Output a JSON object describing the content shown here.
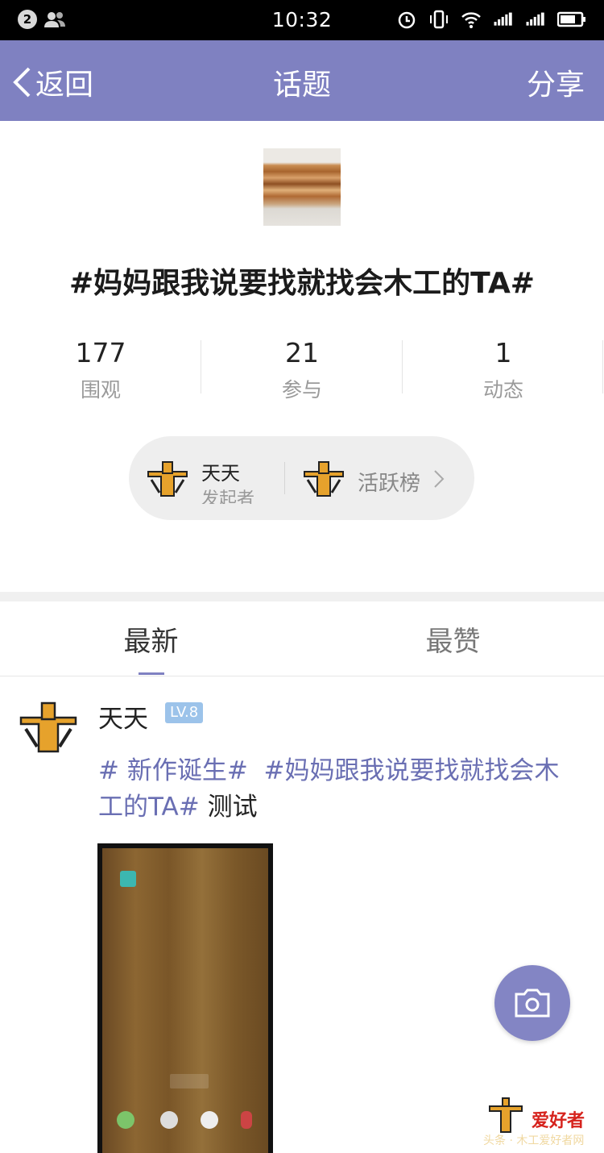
{
  "status_bar": {
    "notification_count": "2",
    "time": "10:32",
    "icons": [
      "people-icon",
      "alarm-icon",
      "vibrate-icon",
      "wifi-icon",
      "signal-1-icon",
      "signal-2-icon",
      "battery-icon"
    ]
  },
  "nav": {
    "back_label": "返回",
    "title": "话题",
    "share_label": "分享"
  },
  "topic": {
    "title": "#妈妈跟我说要找就找会木工的TA#",
    "stats": [
      {
        "value": "177",
        "label": "围观"
      },
      {
        "value": "21",
        "label": "参与"
      },
      {
        "value": "1",
        "label": "动态"
      }
    ],
    "initiator": {
      "name": "天天",
      "role": "发起者"
    },
    "ranking_label": "活跃榜"
  },
  "tabs": [
    {
      "label": "最新",
      "active": true
    },
    {
      "label": "最赞",
      "active": false
    }
  ],
  "post": {
    "author": "天天",
    "level": "LV.8",
    "hashtag_1": "# 新作诞生#",
    "hashtag_2": "#妈妈跟我说要找就找会木工的TA#",
    "text": " 测试"
  },
  "watermark": {
    "brand": "爱好者",
    "sub": "头条 · 木工爱好者网"
  },
  "colors": {
    "accent": "#7f81c1",
    "hashtag": "#6a6fb3",
    "level_badge": "#9cc3ea"
  }
}
